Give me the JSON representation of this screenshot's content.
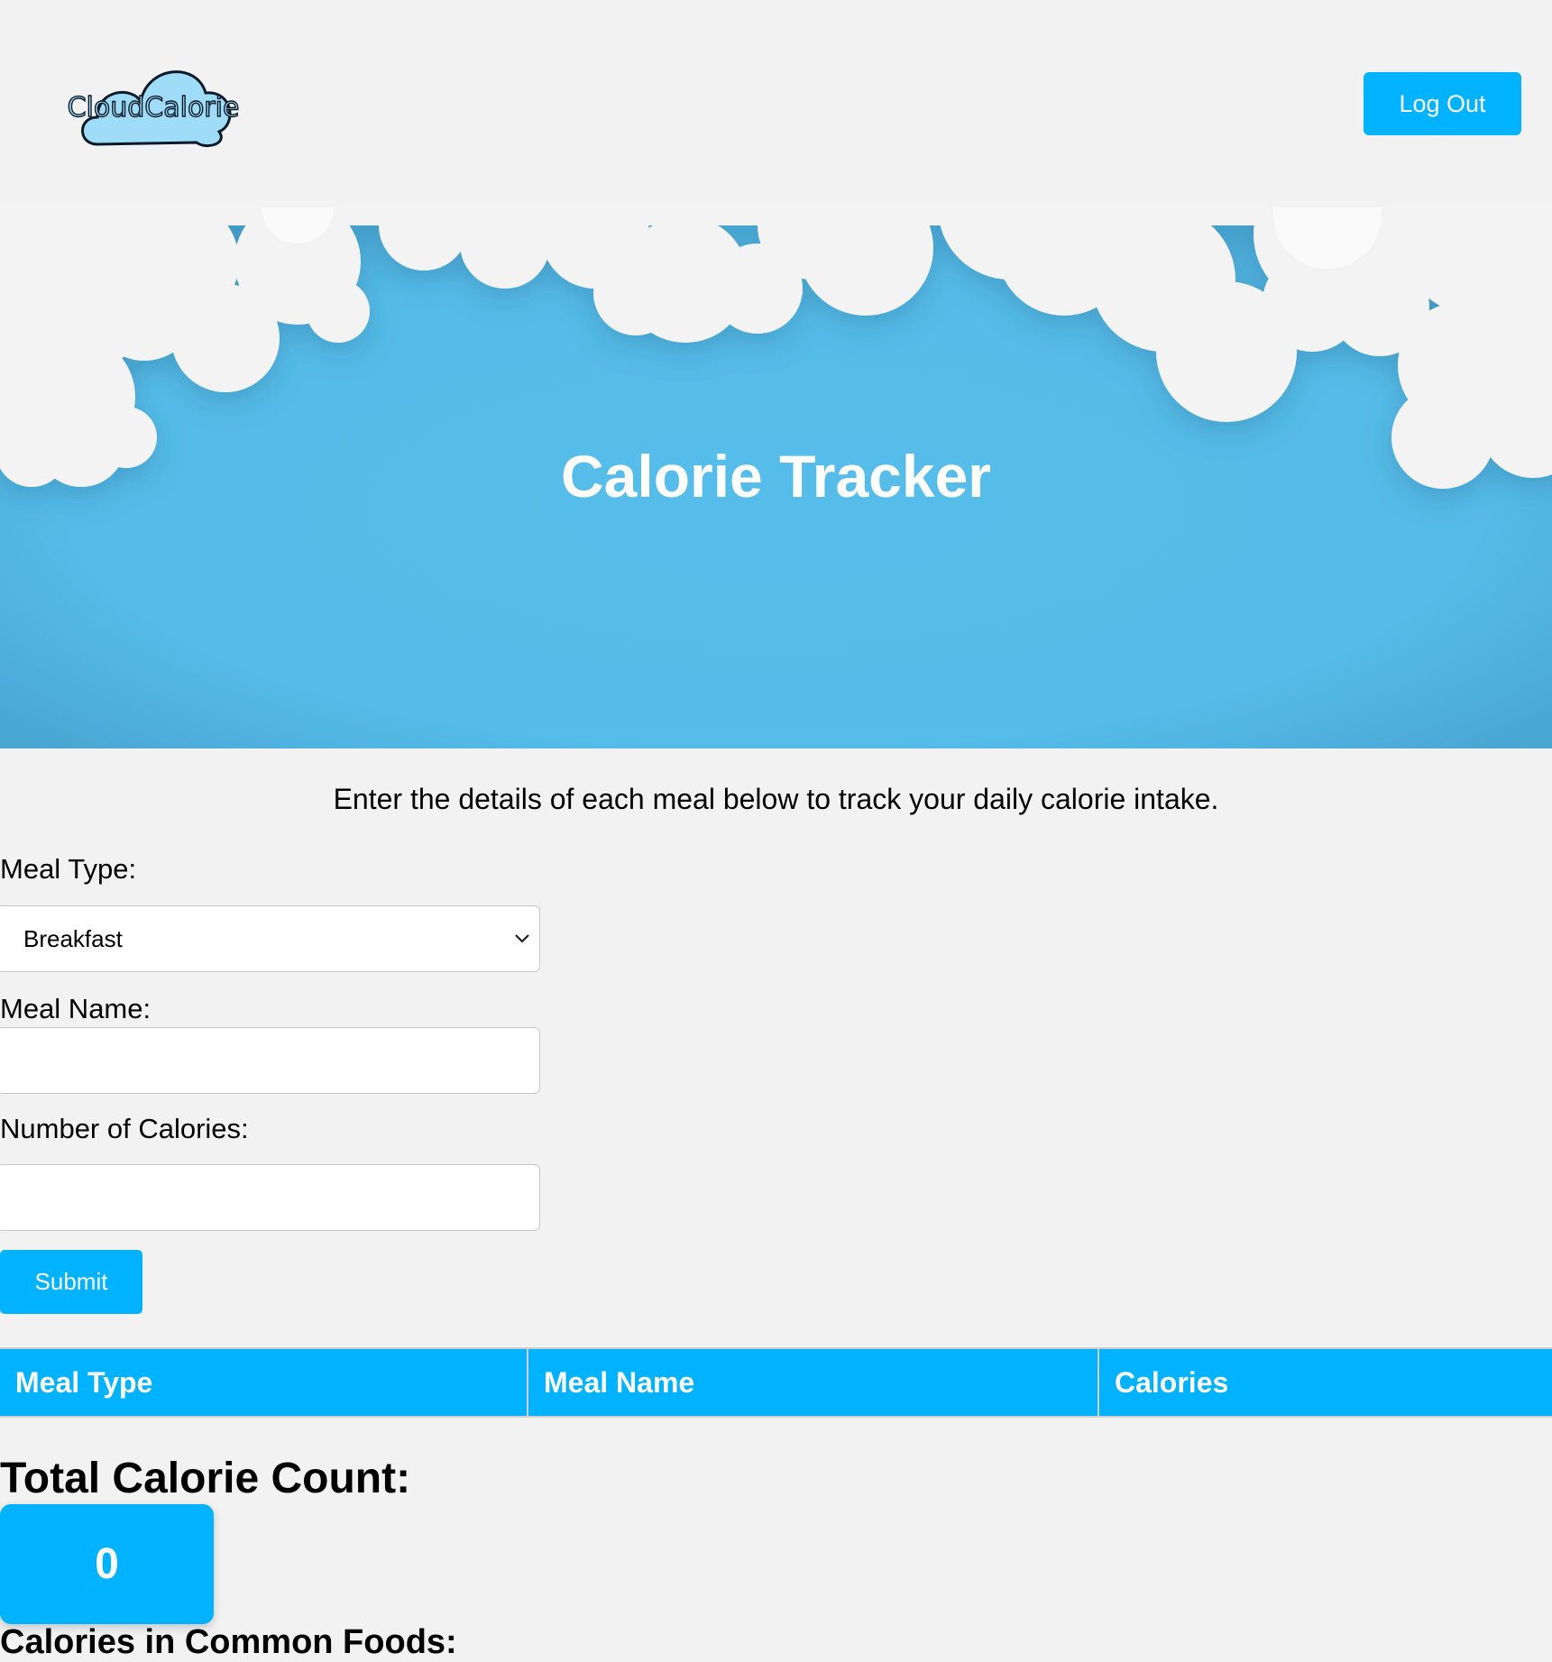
{
  "header": {
    "logo_text": "CloudCalorie",
    "logout_label": "Log Out"
  },
  "hero": {
    "title": "Calorie Tracker"
  },
  "intro": "Enter the details of each meal below to track your daily calorie intake.",
  "form": {
    "meal_type_label": "Meal Type:",
    "meal_type_value": "Breakfast",
    "meal_name_label": "Meal Name:",
    "meal_name_value": "",
    "calories_label": "Number of Calories:",
    "calories_value": "",
    "submit_label": "Submit"
  },
  "table": {
    "columns": [
      "Meal Type",
      "Meal Name",
      "Calories"
    ],
    "rows": []
  },
  "total": {
    "title": "Total Calorie Count:",
    "value": "0"
  },
  "common_foods_title": "Calories in Common Foods:",
  "colors": {
    "accent": "#00b2ff",
    "hero_sky": "#55bbe8",
    "background": "#f2f2f2"
  }
}
